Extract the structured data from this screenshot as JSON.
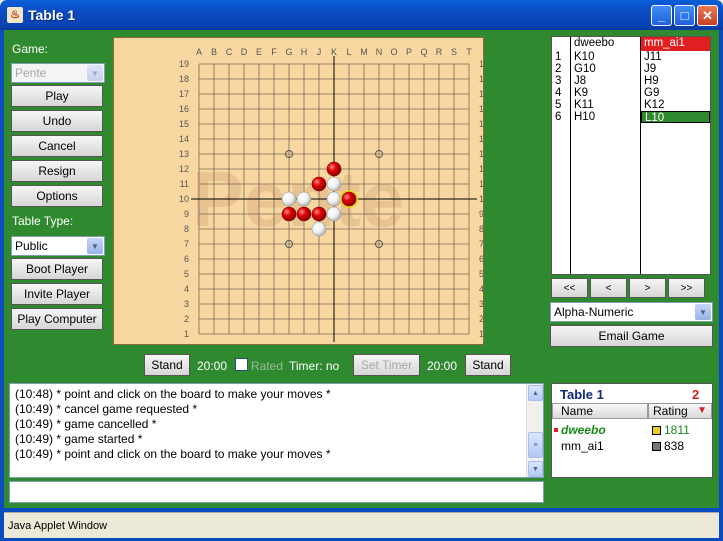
{
  "window": {
    "title": "Table 1",
    "minimize": "_",
    "maximize": "□",
    "close": "✕"
  },
  "left": {
    "game_label": "Game:",
    "game_select": "Pente",
    "buttons": {
      "play": "Play",
      "undo": "Undo",
      "cancel": "Cancel",
      "resign": "Resign",
      "options": "Options"
    },
    "table_type_label": "Table Type:",
    "table_type": "Public",
    "boot": "Boot Player",
    "invite": "Invite Player",
    "play_computer": "Play Computer"
  },
  "board": {
    "watermark": "Pente",
    "columns": [
      "A",
      "B",
      "C",
      "D",
      "E",
      "F",
      "G",
      "H",
      "J",
      "K",
      "L",
      "M",
      "N",
      "O",
      "P",
      "Q",
      "R",
      "S",
      "T"
    ],
    "rows": [
      "19",
      "18",
      "17",
      "16",
      "15",
      "14",
      "13",
      "12",
      "11",
      "10",
      "9",
      "8",
      "7",
      "6",
      "5",
      "4",
      "3",
      "2",
      "1"
    ],
    "stones": [
      {
        "pt": "K12",
        "c": "red"
      },
      {
        "pt": "J11",
        "c": "red"
      },
      {
        "pt": "K11",
        "c": "white"
      },
      {
        "pt": "G10",
        "c": "white"
      },
      {
        "pt": "H10",
        "c": "white"
      },
      {
        "pt": "K10",
        "c": "white"
      },
      {
        "pt": "L10",
        "c": "red",
        "last": true
      },
      {
        "pt": "G9",
        "c": "red"
      },
      {
        "pt": "H9",
        "c": "red"
      },
      {
        "pt": "J9",
        "c": "red"
      },
      {
        "pt": "K9",
        "c": "white"
      },
      {
        "pt": "J8",
        "c": "white"
      }
    ],
    "stars": [
      "G13",
      "N13",
      "G7",
      "N7",
      "K10"
    ]
  },
  "timers": {
    "stand_left": "Stand",
    "time_left": "20:00",
    "rated": "Rated",
    "timer_text": "Timer: no",
    "set_timer": "Set Timer",
    "time_right": "20:00",
    "stand_right": "Stand"
  },
  "movelist": {
    "player1": "dweebo",
    "player2": "mm_ai1",
    "nums": [
      "1",
      "2",
      "3",
      "4",
      "5",
      "6"
    ],
    "p1_moves": [
      "K10",
      "G10",
      "J8",
      "K9",
      "K11",
      "H10"
    ],
    "p2_moves": [
      "J11",
      "J9",
      "H9",
      "G9",
      "K12",
      "L10"
    ],
    "nav": [
      "<<",
      "<",
      ">",
      ">>"
    ],
    "notation": "Alpha-Numeric",
    "email": "Email Game"
  },
  "chat": {
    "lines": [
      "(10:48) * point and click on the board to make your moves *",
      "(10:49) * cancel game requested *",
      "(10:49) * game cancelled *",
      "(10:49) * game started *",
      "(10:49) * point and click on the board to make your moves *"
    ],
    "input": ""
  },
  "players": {
    "table": "Table 1",
    "count": "2",
    "col_name": "Name",
    "col_rating": "Rating",
    "list": [
      {
        "name": "dweebo",
        "rating": "1811",
        "color": "#e8d020"
      },
      {
        "name": "mm_ai1",
        "rating": "838",
        "color": "#777777"
      }
    ]
  },
  "status": "Java Applet Window",
  "colors": {
    "felt": "#2f8a2f",
    "board": "#f9d7a1",
    "red_stone": "#e00000",
    "highlight": "#e8d020"
  }
}
